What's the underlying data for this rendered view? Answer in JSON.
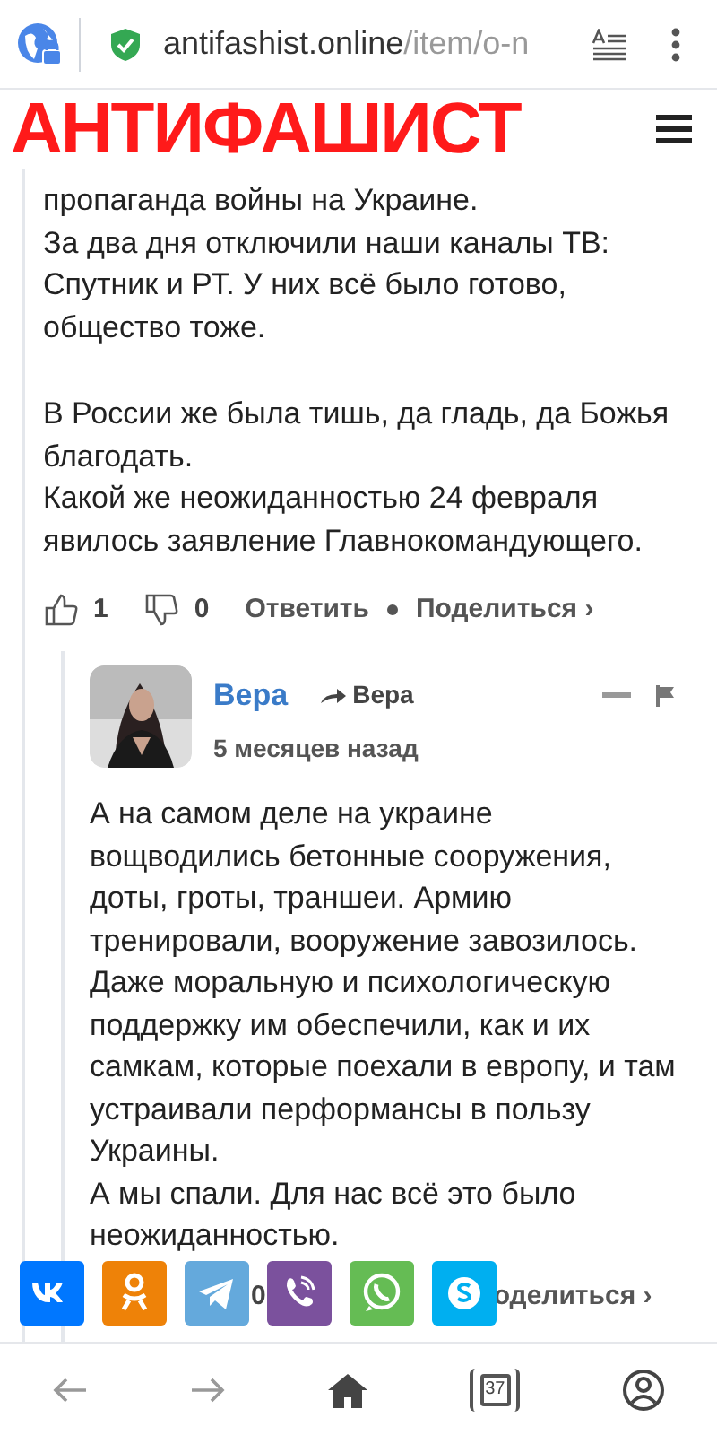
{
  "browser": {
    "domain": "antifashist.online",
    "path": "/item/o-n"
  },
  "site": {
    "logo": "АНТИФАШИСТ"
  },
  "comment": {
    "paragraphs": [
      "пропаганда войны на Украине.\nЗа два дня отключили наши каналы ТВ: Спутник и РТ. У них всё было готово, общество тоже.",
      "В России же была тишь, да гладь, да Божья благодать.\nКакой же неожиданностью 24 февраля явилось заявление Главнокомандующего."
    ],
    "likes": "1",
    "dislikes": "0",
    "reply": "Ответить",
    "share": "Поделиться ›"
  },
  "reply_comment": {
    "author": "Вера",
    "reply_to": "Вера",
    "time": "5 месяцев назад",
    "text": "А на самом деле на украине вощводились бетонные сооружения, доты, гроты, траншеи. Армию тренировали, вооружение завозилось. Даже моральную и психологическую поддержку им обеспечили, как и их самкам, которые поехали в европу, и там устраивали перформансы в пользу Украины.\nА мы спали. Для нас всё это было неожиданностью.",
    "dislikes": "0",
    "share": "оделиться ›"
  },
  "share_bar": [
    {
      "kind": "vk",
      "color": "#0077ff"
    },
    {
      "kind": "ok",
      "color": "#ee8208"
    },
    {
      "kind": "telegram",
      "color": "#64a9dc"
    },
    {
      "kind": "viber",
      "color": "#7b519d"
    },
    {
      "kind": "whatsapp",
      "color": "#65bc54"
    },
    {
      "kind": "skype",
      "color": "#00aff0"
    }
  ],
  "bottom_nav": {
    "tabs_count": "37"
  }
}
